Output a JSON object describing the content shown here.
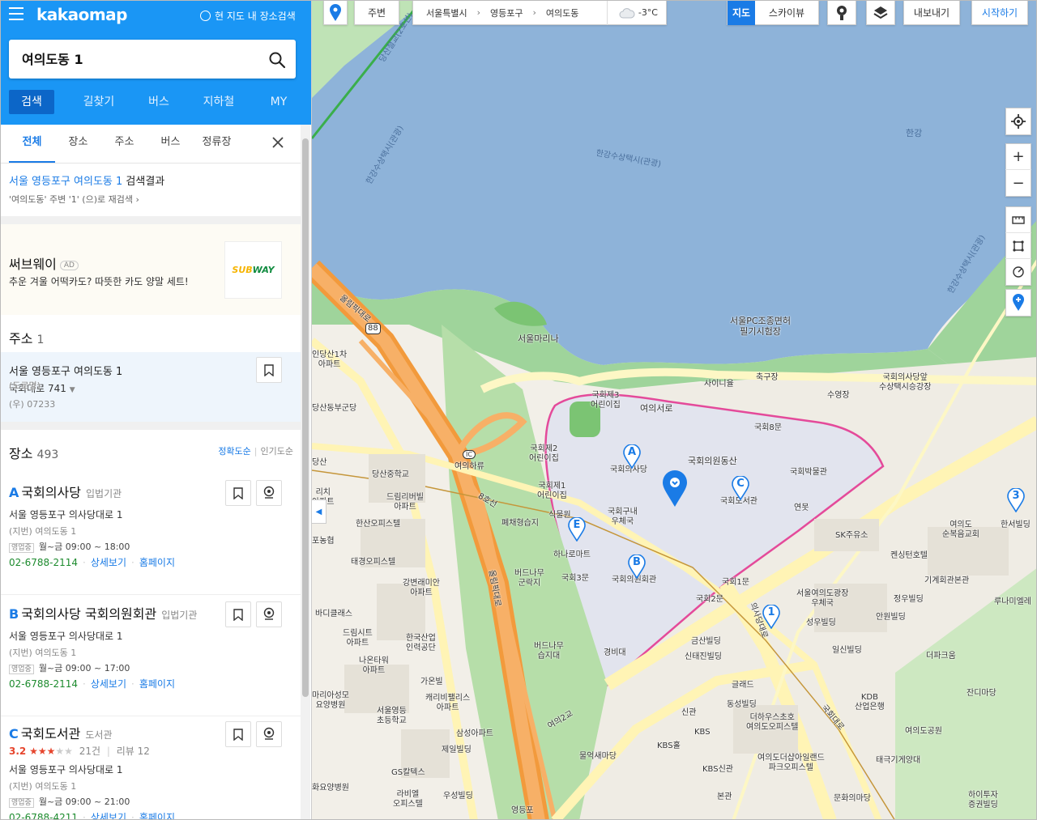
{
  "header": {
    "logo": "kakaomap",
    "area_search_label": "현 지도 내 장소검색",
    "search_value": "여의도동 1",
    "nav_tabs": [
      "검색",
      "길찾기",
      "버스",
      "지하철",
      "MY"
    ]
  },
  "subtabs": [
    "전체",
    "장소",
    "주소",
    "버스",
    "정류장"
  ],
  "result": {
    "query_link": "서울 영등포구 여의도동 1",
    "query_suffix": "검색결과",
    "research_text": "'여의도동' 주변 '1' (으)로 재검색"
  },
  "ad": {
    "title": "써브웨이",
    "badge": "AD",
    "desc": "추운 겨울 어떡카도? 따뜻한 카도 양말 세트!",
    "logo_text_a": "SUB",
    "logo_text_b": "WAY"
  },
  "address_section": {
    "title": "주소",
    "count": "1",
    "item": {
      "main": "서울 영등포구 여의도동 1",
      "road_label": "(도로명)",
      "road": "국회대로 741",
      "zip": "(우) 07233"
    }
  },
  "place_section": {
    "title": "장소",
    "count": "493",
    "sort_on": "정확도순",
    "sort_off": "인기도순",
    "items": [
      {
        "marker": "A",
        "name": "국회의사당",
        "category": "입법기관",
        "address": "서울 영등포구 의사당대로 1",
        "jibun": "(지번) 여의도동 1",
        "hours_tag": "영업중",
        "hours": "월~금 09:00 ~ 18:00",
        "phone": "02-6788-2114",
        "detail": "상세보기",
        "homepage": "홈페이지"
      },
      {
        "marker": "B",
        "name": "국회의사당 국회의원회관",
        "category": "입법기관",
        "address": "서울 영등포구 의사당대로 1",
        "jibun": "(지번) 여의도동 1",
        "hours_tag": "영업중",
        "hours": "월~금 09:00 ~ 17:00",
        "phone": "02-6788-2114",
        "detail": "상세보기",
        "homepage": "홈페이지"
      },
      {
        "marker": "C",
        "name": "국회도서관",
        "category": "도서관",
        "score": "3.2",
        "rating_stars": 3,
        "review_count": "21건",
        "review_label": "리뷰 12",
        "address": "서울 영등포구 의사당대로 1",
        "jibun": "(지번) 여의도동 1",
        "hours_tag": "영업중",
        "hours": "월~금 09:00 ~ 21:00",
        "phone": "02-6788-4211",
        "detail": "상세보기",
        "homepage": "홈페이지"
      }
    ]
  },
  "map_toolbar": {
    "near": "주변",
    "breadcrumb": [
      "서울특별시",
      "영등포구",
      "여의도동"
    ],
    "temperature": "-3°C",
    "map_type_active": "지도",
    "map_type_other": "스카이뷰",
    "export": "내보내기",
    "start": "시작하기"
  },
  "map_labels": {
    "hangang": "한강",
    "taxi1": "한강수상택시(관광)",
    "taxi2": "한강수상택시(관광)",
    "taxi3": "한강수상택시(관광)",
    "taxi4": "한강수상택시(관광)",
    "dangsan": "당산철교(2호선)",
    "olympic": "올림픽대로",
    "olympic2": "올림픽대로",
    "marina": "서울마리나",
    "pc": "서울PC조종면허\n필기시험장",
    "taxistation": "국회의사당앞\n수상택시승강장",
    "sairinyul": "사이니율",
    "soccer": "축구장",
    "swim": "수영장",
    "yeouiseoro": "여의서로",
    "ns8": "국회8문",
    "ns3": "국회제3\n어린이집",
    "ns2": "국회제2\n어린이집",
    "ns1": "국회제1\n어린이집",
    "hill": "국회의원동산",
    "assembly": "국회의사당",
    "museum": "국회박물관",
    "library": "국회도서관",
    "pond": "연못",
    "post": "국회구내\n우체국",
    "mart": "하나로마트",
    "ns3moon": "국회3문",
    "members": "국회의원회관",
    "ns1moon": "국회1문",
    "ns2moon": "국회2문",
    "guard": "경비대",
    "cafeteria": "식물원",
    "yeouiharu": "여의하류",
    "dangsanmid": "당산중학교",
    "dream": "드림리버빌\n아파트",
    "hansan": "한산오피스텔",
    "taegyeong": "태경오피스텔",
    "ganghyeon": "강변래미안\n아파트",
    "badi": "바디클래스",
    "dreamcity": "드림시트\n아파트",
    "hankook": "한국산업\n인력공단",
    "naon": "나온타워\n아파트",
    "gaon": "가온빌",
    "caribbean": "캐리비팰리스\n아파트",
    "yeongdeung": "서울영등\n초등학교",
    "samsung": "삼성아파트",
    "jeil": "제일빌딩",
    "gs": "GS칼텍스",
    "labi": "라비엘\n오피스텔",
    "woosung": "우성빌딩",
    "hwayang": "화요양병원",
    "mario": "마리아성모\n요양병원",
    "apt1": "인당산1차\n아파트",
    "army": "당산동부군당",
    "tong": "리치\n아파트",
    "jangnong": "포농협",
    "gangseo": "당산",
    "budnamu1": "버드나무\n군락지",
    "budnamu2": "버드나무\n습지대",
    "pyeewater": "폐채형습지",
    "mulyeok": "물억새마당",
    "yeouigyo": "여의2교",
    "yeoui8": "8호선",
    "keumsan": "금산빌딩",
    "sintaejin": "신태진빌딩",
    "glad": "글래드",
    "dongsung": "동성빌딩",
    "theking": "더하우스초호\n여의도오피스텔",
    "sin": "신관",
    "kbs": "KBS",
    "kbshall": "KBS홀",
    "kbsnew": "KBS신관",
    "main": "본관",
    "thehyundai": "여의도더샵아일랜드\n파크오피스텔",
    "sk": "SK주유소",
    "kensington": "켄싱턴호텔",
    "yeouipost": "서울여의도광장\n우체국",
    "seongwoo": "성우빌딩",
    "jungwoo": "정우빌딩",
    "anwon": "안원빌딩",
    "ilsin": "일신빌딩",
    "kdb": "KDB\n산업은행",
    "gihoe": "기계회관본관",
    "church": "여의도\n순복음교회",
    "hansin": "한서빌딩",
    "rue": "루나미엘레",
    "deparque": "더파크움",
    "jandi": "잔디마당",
    "park": "여의도공원",
    "taegukgi": "태극기게양대",
    "culture": "문화의마당",
    "hana": "하이투자\n증권빌딩",
    "yeongdeungpo": "영등포",
    "ns88": "88",
    "ic": "IC",
    "ramp": "국회대로",
    "daero": "의사당대로"
  },
  "map_markers": [
    "A",
    "B",
    "C",
    "E",
    "1",
    "3"
  ],
  "colors": {
    "brand": "#1a96f5",
    "accent": "#1a7be6",
    "boundary": "#e44a9a",
    "water": "#8eb3d9",
    "park": "#9fd49b"
  }
}
